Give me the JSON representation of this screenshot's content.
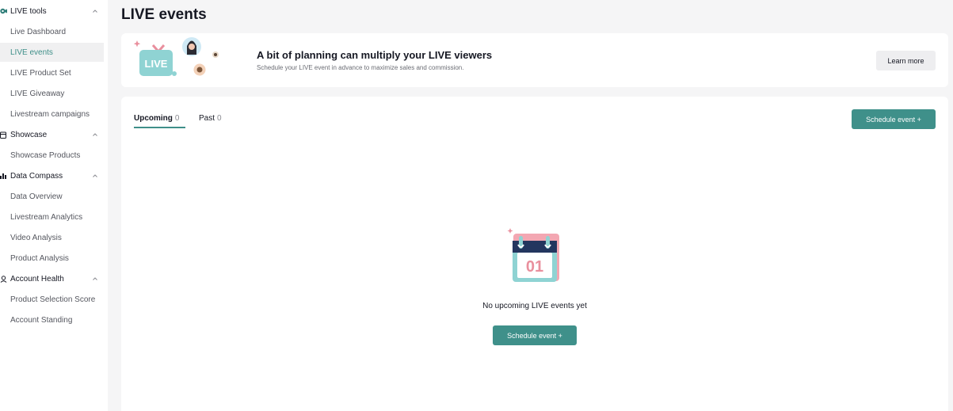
{
  "sidebar": {
    "groups": [
      {
        "label": "LIVE tools",
        "icon": "live-camera-icon",
        "items": [
          "Live Dashboard",
          "LIVE events",
          "LIVE Product Set",
          "LIVE Giveaway",
          "Livestream campaigns"
        ]
      },
      {
        "label": "Showcase",
        "icon": "store-icon",
        "items": [
          "Showcase Products"
        ]
      },
      {
        "label": "Data Compass",
        "icon": "bar-chart-icon",
        "items": [
          "Data Overview",
          "Livestream Analytics",
          "Video Analysis",
          "Product Analysis"
        ]
      },
      {
        "label": "Account Health",
        "icon": "user-shield-icon",
        "items": [
          "Product Selection Score",
          "Account Standing"
        ]
      }
    ],
    "active_item": "LIVE events"
  },
  "page": {
    "title": "LIVE events"
  },
  "banner": {
    "badge_text": "LIVE",
    "title": "A bit of planning can multiply your LIVE viewers",
    "subtitle": "Schedule your LIVE event in advance to maximize sales and commission.",
    "learn_more": "Learn more"
  },
  "tabs": [
    {
      "label": "Upcoming",
      "count": "0",
      "active": true
    },
    {
      "label": "Past",
      "count": "0",
      "active": false
    }
  ],
  "schedule_button": "Schedule event +",
  "empty_state": {
    "calendar_day": "01",
    "message": "No upcoming LIVE events yet",
    "button": "Schedule event +"
  },
  "colors": {
    "accent": "#3f908a",
    "active_nav": "#3f8f89",
    "calendar_pink": "#e98f9d",
    "calendar_teal": "#8fd3d3",
    "calendar_navy": "#23365f"
  }
}
